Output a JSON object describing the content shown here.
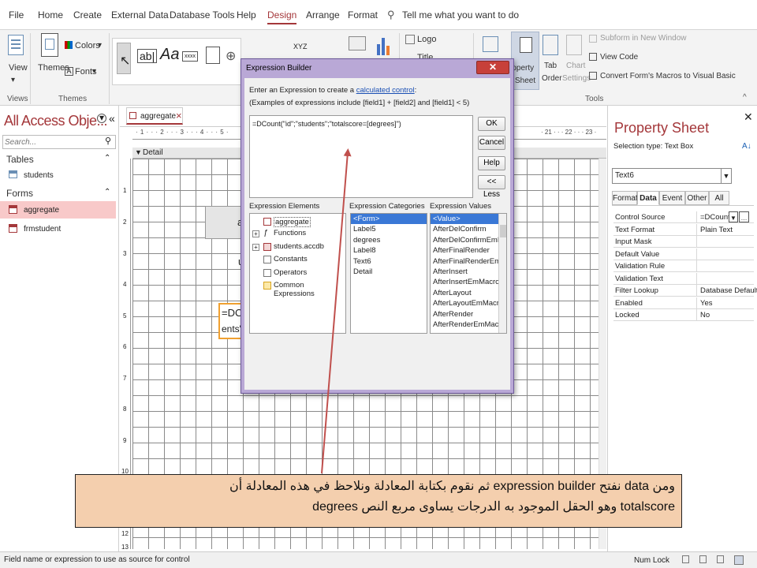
{
  "menu": {
    "items": [
      "File",
      "Home",
      "Create",
      "External Data",
      "Database Tools",
      "Help",
      "Design",
      "Arrange",
      "Format"
    ],
    "active": "Design",
    "tell_me": "Tell me what you want to do"
  },
  "ribbon": {
    "views_label": "View",
    "themes_label": "Themes",
    "colors_label": "Colors",
    "fonts_label": "Fonts",
    "logo_label": "Logo",
    "title_label": "Title",
    "property_sheet_label": "Property Sheet",
    "property_sheet_line1": "roperty",
    "property_sheet_line2": "Sheet",
    "tab_order_label1": "Tab",
    "tab_order_label2": "Order",
    "chart_settings_label1": "Chart",
    "chart_settings_label2": "Settings",
    "subform_label": "Subform in New Window",
    "view_code_label": "View Code",
    "convert_macros_label": "Convert Form's Macros to Visual Basic",
    "group_views": "Views",
    "group_themes": "Themes",
    "group_tools": "Tools",
    "textbox_icon_text": "ab|",
    "label_icon_text": "Aa",
    "xxxx_icon_text": "xxxx",
    "xyz_icon_text": "XYZ"
  },
  "nav": {
    "title": "All Access Obje...",
    "search_placeholder": "Search...",
    "tables_header": "Tables",
    "tables": [
      "students"
    ],
    "forms_header": "Forms",
    "forms": [
      "aggregate",
      "frmstudent"
    ],
    "selected_form": "aggregate"
  },
  "form": {
    "tab_label": "aggregate",
    "section_label": "Detail",
    "ruler_numbers": [
      "1",
      "2",
      "3",
      "4",
      "5",
      "6",
      "7",
      "8",
      "9",
      "10",
      "11",
      "12",
      "13"
    ],
    "top_ruler_text": "· 1 · · · 2 · · · 3 · · · 4 · · · 5 ·",
    "top_ruler_right": "· 21 · · · 22 · · · 23 ·",
    "textbox_line1": "=DC",
    "textbox_line2": "ents\"",
    "label_fragment1": "a",
    "label_fragment2": "u"
  },
  "dialog": {
    "title": "Expression Builder",
    "prompt_prefix": "Enter an Expression to create a ",
    "prompt_link": "calculated control",
    "prompt_suffix": ":",
    "example": "(Examples of expressions include [field1] + [field2] and [field1] < 5)",
    "expression": "=DCount(\"id\";\"students\";\"totalscore=[degrees]\")",
    "buttons": {
      "ok": "OK",
      "cancel": "Cancel",
      "help": "Help",
      "less": "<< Less"
    },
    "elements_header": "Expression Elements",
    "categories_header": "Expression Categories",
    "values_header": "Expression Values",
    "elements": [
      "aggregate",
      "Functions",
      "students.accdb",
      "Constants",
      "Operators",
      "Common Expressions"
    ],
    "categories": [
      "<Form>",
      "Label5",
      "degrees",
      "Label8",
      "Text6",
      "Detail"
    ],
    "values": [
      "<Value>",
      "AfterDelConfirm",
      "AfterDelConfirmEmMacro",
      "AfterFinalRender",
      "AfterFinalRenderEmMacro",
      "AfterInsert",
      "AfterInsertEmMacro",
      "AfterLayout",
      "AfterLayoutEmMacro",
      "AfterRender",
      "AfterRenderEmMacro"
    ]
  },
  "property_sheet": {
    "title": "Property Sheet",
    "selection_type": "Selection type:  Text Box",
    "selected_control": "Text6",
    "tabs": [
      "Format",
      "Data",
      "Event",
      "Other",
      "All"
    ],
    "active_tab": "Data",
    "rows": [
      {
        "name": "Control Source",
        "value": "=DCount(\""
      },
      {
        "name": "Text Format",
        "value": "Plain Text"
      },
      {
        "name": "Input Mask",
        "value": ""
      },
      {
        "name": "Default Value",
        "value": ""
      },
      {
        "name": "Validation Rule",
        "value": ""
      },
      {
        "name": "Validation Text",
        "value": ""
      },
      {
        "name": "Filter Lookup",
        "value": "Database Default"
      },
      {
        "name": "Enabled",
        "value": "Yes"
      },
      {
        "name": "Locked",
        "value": "No"
      }
    ]
  },
  "status": {
    "left": "Field name or expression to use as source for control",
    "num_lock": "Num Lock"
  },
  "callout": {
    "line1": "ومن data نفتح expression builder ثم نقوم بكتابة المعادلة ونلاحظ في هذه المعادلة أن",
    "line2": "totalscore وهو الحقل الموجود به الدرجات يساوى مربع النص degrees"
  },
  "colors": {
    "accent": "#a4373a",
    "dialog_frame": "#b9a8d6",
    "callout_bg": "#f4cfae",
    "arrow": "#c0504d",
    "selection": "#3a78d6",
    "nav_selected": "#f8c9c9"
  }
}
